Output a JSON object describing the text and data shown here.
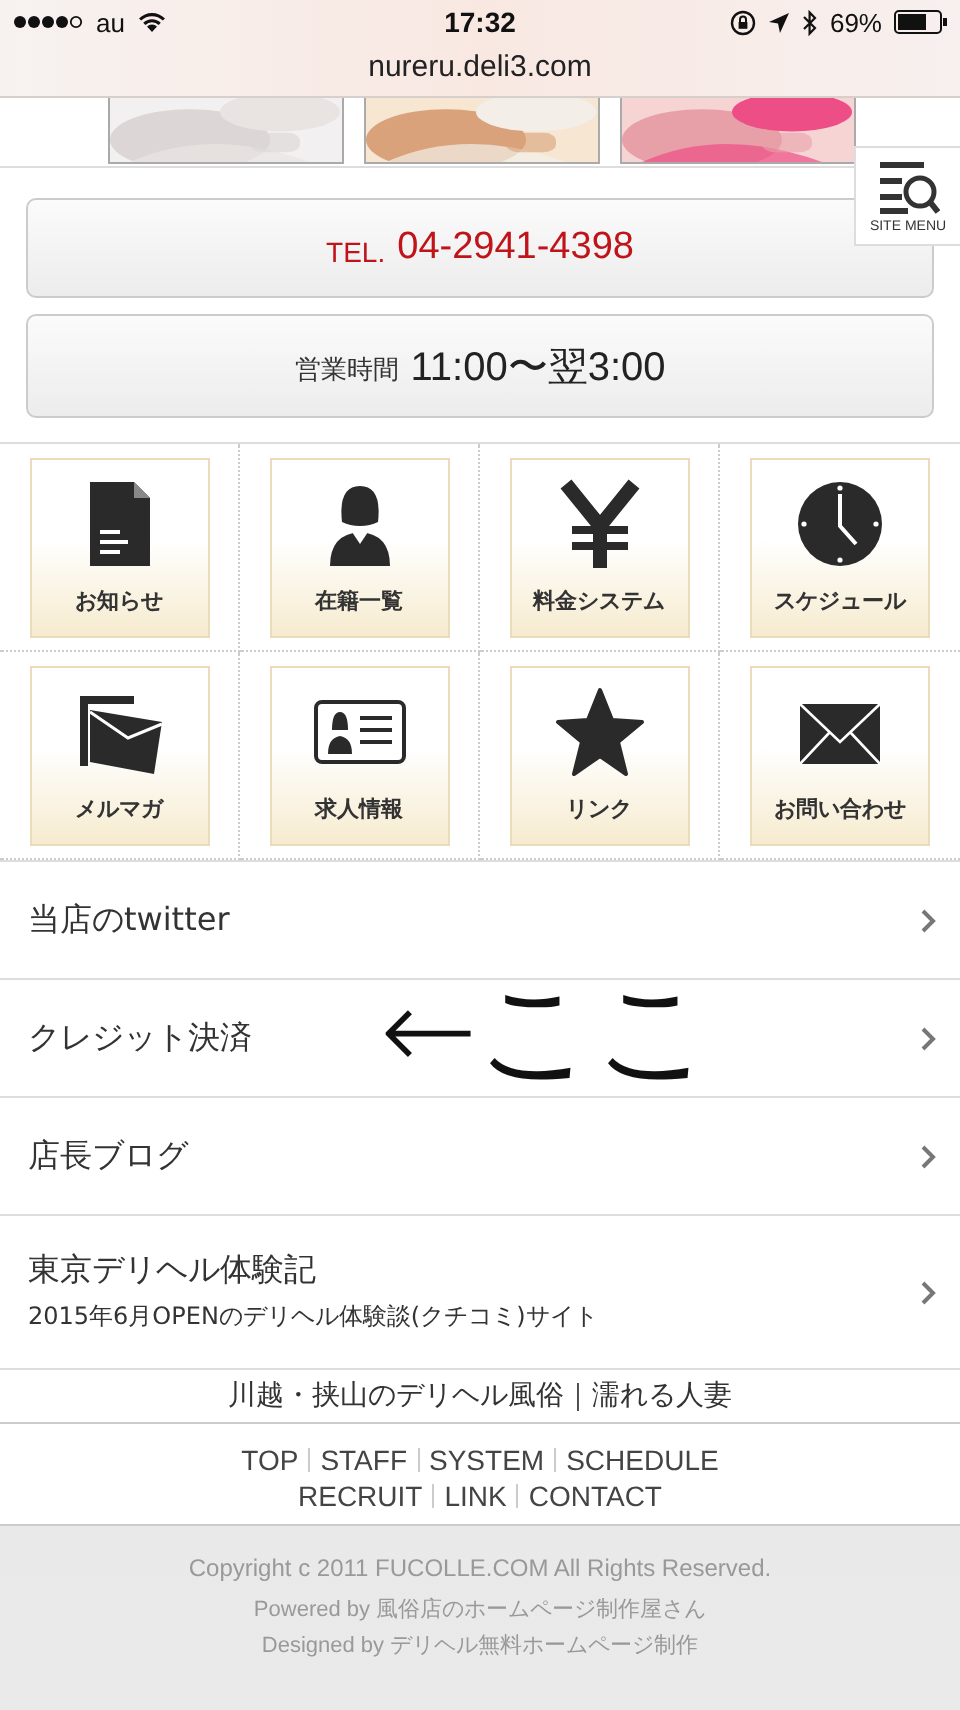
{
  "status_bar": {
    "carrier": "au",
    "time": "17:32",
    "battery": "69%"
  },
  "url": "nureru.deli3.com",
  "photos": [
    {
      "kind": "picture"
    },
    {
      "kind": "picture"
    },
    {
      "kind": "picture"
    }
  ],
  "site_menu": {
    "label": "SITE MENU"
  },
  "tel": {
    "prefix": "TEL.",
    "number": "04-2941-4398"
  },
  "hours": {
    "label": "営業時間",
    "value": "11:00〜翌3:00"
  },
  "tiles": [
    {
      "label": "お知らせ",
      "kind": "document"
    },
    {
      "label": "在籍一覧",
      "kind": "woman"
    },
    {
      "label": "料金システム",
      "kind": "yen"
    },
    {
      "label": "スケジュール",
      "kind": "clock"
    },
    {
      "label": "メルマガ",
      "kind": "mailbox"
    },
    {
      "label": "求人情報",
      "kind": "card"
    },
    {
      "label": "リンク",
      "kind": "star"
    },
    {
      "label": "お問い合わせ",
      "kind": "envelope"
    }
  ],
  "links": [
    {
      "title": "当店のtwitter"
    },
    {
      "title": "クレジット決済",
      "annotation": "←ここ"
    },
    {
      "title": "店長ブログ"
    },
    {
      "title": "東京デリヘル体験記",
      "subtitle": "2015年6月OPENのデリヘル体験談(クチコミ)サイト"
    }
  ],
  "site_title": "川越・挟山のデリヘル風俗｜濡れる人妻",
  "footer_nav": [
    [
      "TOP",
      "STAFF",
      "SYSTEM",
      "SCHEDULE"
    ],
    [
      "RECRUIT",
      "LINK",
      "CONTACT"
    ]
  ],
  "copyright": "Copyright c 2011 FUCOLLE.COM All Rights Reserved.",
  "credits": [
    "Powered by 風俗店のホームページ制作屋さん",
    "Designed by デリヘル無料ホームページ制作"
  ]
}
